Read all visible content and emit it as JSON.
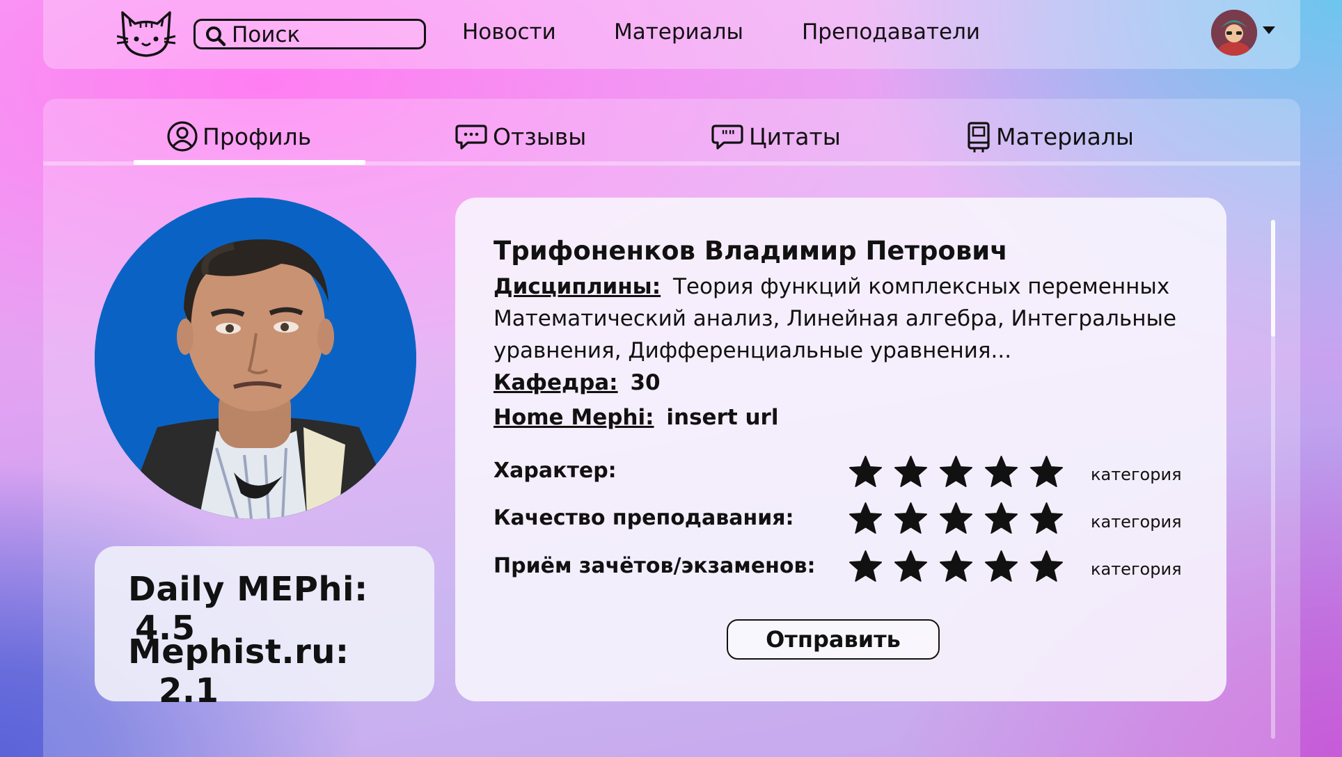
{
  "header": {
    "logo_icon": "cat-face-icon",
    "search": {
      "placeholder": "Поиск",
      "icon": "search-icon"
    },
    "nav": [
      "Новости",
      "Материалы",
      "Преподаватели"
    ],
    "user_avatar_icon": "user-avatar",
    "menu_icon": "caret-down-icon"
  },
  "tabs": [
    {
      "label": "Профиль",
      "icon": "user-circle-icon",
      "active": true
    },
    {
      "label": "Отзывы",
      "icon": "chat-bubble-icon",
      "active": false
    },
    {
      "label": "Цитаты",
      "icon": "quote-bubble-icon",
      "active": false
    },
    {
      "label": "Материалы",
      "icon": "book-icon",
      "active": false
    }
  ],
  "ratings": [
    {
      "source": "Daily MEPhi:",
      "value": "4.5"
    },
    {
      "source": "Mephist.ru:",
      "value": "2.1"
    }
  ],
  "profile": {
    "name": "Трифоненков Владимир Петрович",
    "disciplines_label": "Дисциплины:",
    "disciplines_value": "Теория функций комплексных переменных Математический анализ, Линейная алгебра, Интегральные уравнения, Дифференциальные уравнения...",
    "department_label": "Кафедра:",
    "department_value": "30",
    "home_label": "Home Mephi:",
    "home_value": "insert url"
  },
  "criteria": [
    {
      "label": "Характер:",
      "stars": 5,
      "category": "категория"
    },
    {
      "label": "Качество преподавания:",
      "stars": 5,
      "category": "категория"
    },
    {
      "label": "Приём зачётов/экзаменов:",
      "stars": 5,
      "category": "категория"
    }
  ],
  "submit_label": "Отправить",
  "colors": {
    "accent_pink": "#ff7ef2",
    "accent_blue": "#6cc6ef",
    "accent_violet": "#5a63d8",
    "text": "#111111"
  }
}
